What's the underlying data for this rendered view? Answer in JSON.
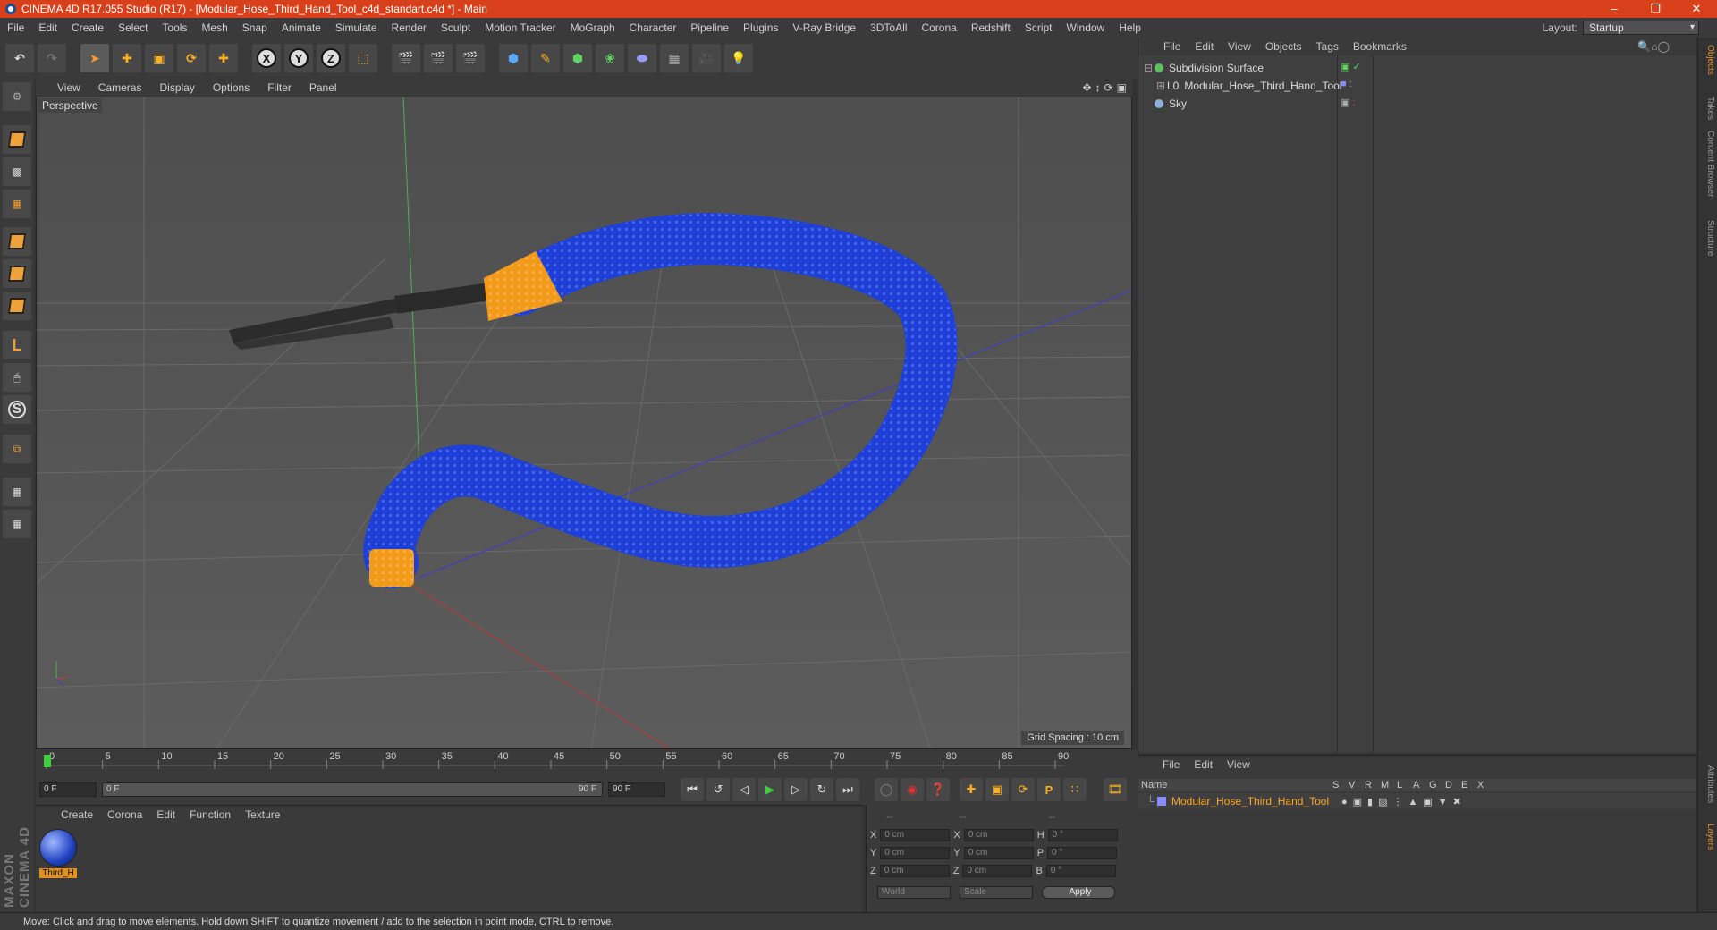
{
  "window": {
    "title": "CINEMA 4D R17.055 Studio (R17) - [Modular_Hose_Third_Hand_Tool_c4d_standart.c4d *] - Main"
  },
  "menu": [
    "File",
    "Edit",
    "Create",
    "Select",
    "Tools",
    "Mesh",
    "Snap",
    "Animate",
    "Simulate",
    "Render",
    "Sculpt",
    "Motion Tracker",
    "MoGraph",
    "Character",
    "Pipeline",
    "Plugins",
    "V-Ray Bridge",
    "3DToAll",
    "Corona",
    "Redshift",
    "Script",
    "Window",
    "Help"
  ],
  "layout": {
    "label": "Layout:",
    "value": "Startup"
  },
  "toolbar": {
    "axis_x": "X",
    "axis_y": "Y",
    "axis_z": "Z"
  },
  "viewport": {
    "menu": [
      "View",
      "Cameras",
      "Display",
      "Options",
      "Filter",
      "Panel"
    ],
    "label": "Perspective",
    "grid_spacing": "Grid Spacing : 10 cm"
  },
  "object_manager": {
    "menu": [
      "File",
      "Edit",
      "View",
      "Objects",
      "Tags",
      "Bookmarks"
    ],
    "objects": [
      {
        "name": "Subdivision Surface",
        "color": "#5fbf5f"
      },
      {
        "name": "Modular_Hose_Third_Hand_Tool",
        "color": "#8a8aff"
      },
      {
        "name": "Sky",
        "color": "#8fb0d8"
      }
    ]
  },
  "side_tabs": [
    "Objects",
    "Takes",
    "Content Browser",
    "Structure"
  ],
  "side_tabs_bottom": [
    "Attributes",
    "Layers"
  ],
  "timeline": {
    "ticks": [
      "0",
      "5",
      "10",
      "15",
      "20",
      "25",
      "30",
      "35",
      "40",
      "45",
      "50",
      "55",
      "60",
      "65",
      "70",
      "75",
      "80",
      "85",
      "90"
    ],
    "current_frame": "0 F",
    "start": "0 F",
    "range_start": "0 F",
    "range_end": "90 F",
    "end": "90 F"
  },
  "material_manager": {
    "menu": [
      "Create",
      "Corona",
      "Edit",
      "Function",
      "Texture"
    ],
    "material_name": "Third_H"
  },
  "coordinates": {
    "headers": [
      "--",
      "--",
      "--"
    ],
    "rows": [
      {
        "l1": "X",
        "v1": "0 cm",
        "l2": "X",
        "v2": "0 cm",
        "l3": "H",
        "v3": "0 °"
      },
      {
        "l1": "Y",
        "v1": "0 cm",
        "l2": "Y",
        "v2": "0 cm",
        "l3": "P",
        "v3": "0 °"
      },
      {
        "l1": "Z",
        "v1": "0 cm",
        "l2": "Z",
        "v2": "0 cm",
        "l3": "B",
        "v3": "0 °"
      }
    ],
    "mode_world": "World",
    "mode_scale": "Scale",
    "apply": "Apply"
  },
  "layer_manager": {
    "menu": [
      "File",
      "Edit",
      "View"
    ],
    "columns": [
      "Name",
      "S",
      "V",
      "R",
      "M",
      "L",
      "A",
      "G",
      "D",
      "E",
      "X"
    ],
    "row_name": "Modular_Hose_Third_Hand_Tool"
  },
  "brand": "MAXON CINEMA 4D",
  "status": "Move: Click and drag to move elements. Hold down SHIFT to quantize movement / add to the selection in point mode, CTRL to remove."
}
